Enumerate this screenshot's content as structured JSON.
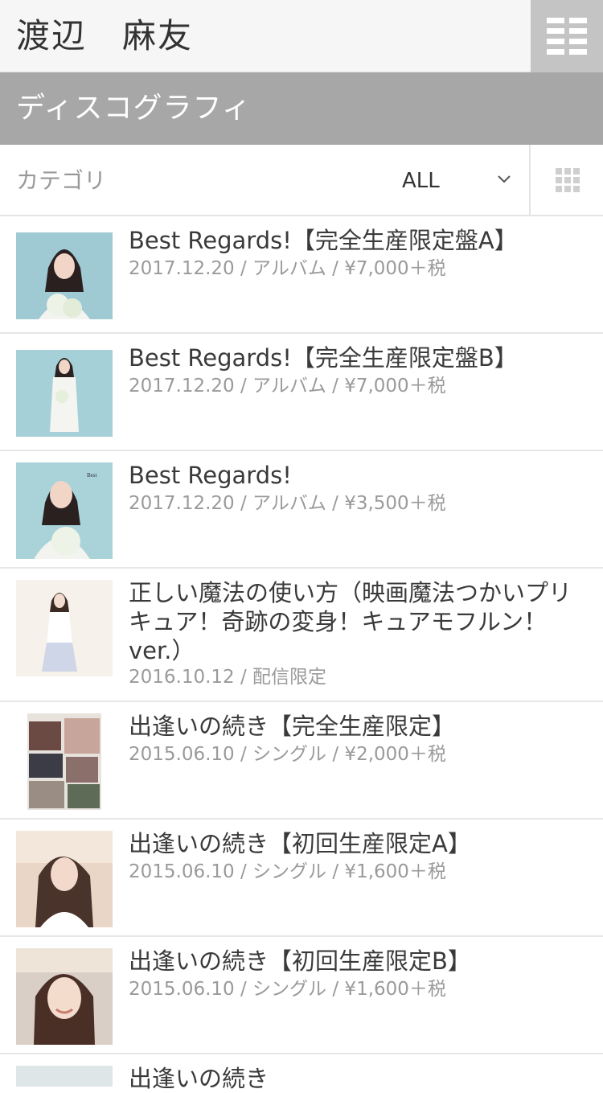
{
  "header": {
    "artist_name": "渡辺　麻友"
  },
  "section": {
    "title": "ディスコグラフィ"
  },
  "filter": {
    "category_label": "カテゴリ",
    "selected": "ALL"
  },
  "items": [
    {
      "title": "Best Regards!【完全生産限定盤A】",
      "meta": "2017.12.20 / アルバム / ¥7,000＋税"
    },
    {
      "title": "Best Regards!【完全生産限定盤B】",
      "meta": "2017.12.20 / アルバム / ¥7,000＋税"
    },
    {
      "title": "Best Regards!",
      "meta": "2017.12.20 / アルバム / ¥3,500＋税"
    },
    {
      "title": "正しい魔法の使い方（映画魔法つかいプリキュア！奇跡の変身！キュアモフルン！ver.）",
      "meta": "2016.10.12 / 配信限定"
    },
    {
      "title": "出逢いの続き【完全生産限定】",
      "meta": "2015.06.10 / シングル / ¥2,000＋税"
    },
    {
      "title": "出逢いの続き【初回生産限定A】",
      "meta": "2015.06.10 / シングル / ¥1,600＋税"
    },
    {
      "title": "出逢いの続き【初回生産限定B】",
      "meta": "2015.06.10 / シングル / ¥1,600＋税"
    },
    {
      "title": "出逢いの続き",
      "meta": ""
    }
  ],
  "icons": {
    "menu": "menu-grid-icon",
    "chevron": "chevron-down-icon",
    "view": "grid-view-icon"
  },
  "colors": {
    "header_bg": "#f6f6f6",
    "menu_bg": "#c4c4c4",
    "section_bg": "#a7a7a7",
    "text": "#333333",
    "meta": "#9a9a9a"
  }
}
